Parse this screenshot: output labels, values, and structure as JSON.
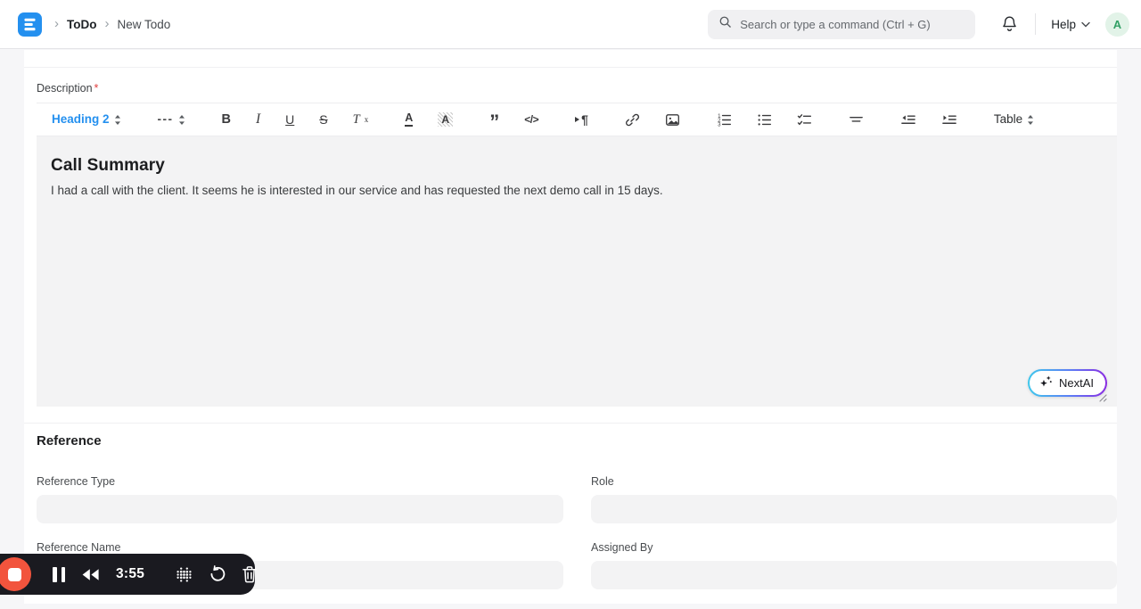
{
  "navbar": {
    "breadcrumb": {
      "separator": "›",
      "items": [
        {
          "label": "ToDo"
        },
        {
          "label": "New Todo"
        }
      ]
    },
    "search": {
      "placeholder": "Search or type a command (Ctrl + G)"
    },
    "help": {
      "label": "Help"
    },
    "avatar": {
      "initial": "A",
      "bg_color": "#e2f3e8",
      "text_color": "#33a066"
    },
    "logo_color": "#2490ef"
  },
  "form": {
    "description": {
      "label": "Description",
      "required_mark": "*"
    },
    "toolbar": {
      "heading_select": "Heading 2",
      "hr_select": "---",
      "bold": "B",
      "italic": "I",
      "underline": "U",
      "strike": "S",
      "clear_format": "T",
      "clear_format_sub": "x",
      "text_color": "A",
      "bg_color": "A",
      "quote": "”",
      "code": "</>",
      "pilcrow": "¶",
      "table_select": "Table"
    },
    "editor": {
      "heading": "Call Summary",
      "body": "I had a call with the client. It seems he is interested in our service and has requested the next demo call in 15 days."
    },
    "nextai": {
      "label": "NextAI",
      "gradient_start": "#3fc8ec",
      "gradient_end": "#8a2be2"
    },
    "reference": {
      "title": "Reference",
      "fields": [
        {
          "label": "Reference Type",
          "value": ""
        },
        {
          "label": "Role",
          "value": ""
        },
        {
          "label": "Reference Name",
          "value": ""
        },
        {
          "label": "Assigned By",
          "value": ""
        }
      ]
    }
  },
  "recorder": {
    "time": "3:55",
    "stop_color": "#f2543d",
    "bar_color": "#1a1a20"
  }
}
